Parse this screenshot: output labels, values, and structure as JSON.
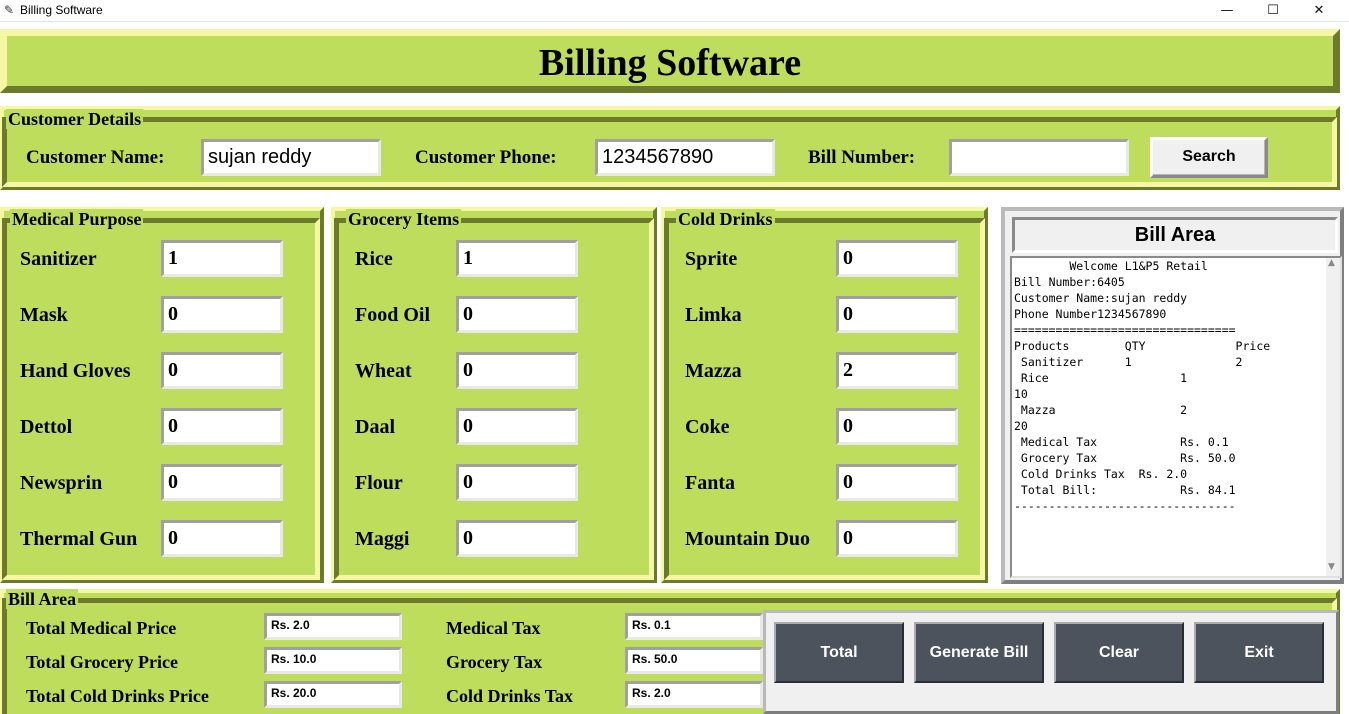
{
  "window": {
    "title": "Billing Software"
  },
  "header": {
    "title": "Billing Software"
  },
  "customer": {
    "frame_label": "Customer Details",
    "name_label": "Customer Name:",
    "name_value": "sujan reddy",
    "phone_label": "Customer Phone:",
    "phone_value": "1234567890",
    "bill_label": "Bill Number:",
    "bill_value": "",
    "search_label": "Search"
  },
  "medical": {
    "frame_label": "Medical Purpose",
    "items": [
      {
        "label": "Sanitizer",
        "value": "1"
      },
      {
        "label": "Mask",
        "value": "0"
      },
      {
        "label": "Hand Gloves",
        "value": "0"
      },
      {
        "label": "Dettol",
        "value": "0"
      },
      {
        "label": "Newsprin",
        "value": "0"
      },
      {
        "label": "Thermal Gun",
        "value": "0"
      }
    ]
  },
  "grocery": {
    "frame_label": "Grocery Items",
    "items": [
      {
        "label": "Rice",
        "value": "1"
      },
      {
        "label": "Food Oil",
        "value": "0"
      },
      {
        "label": "Wheat",
        "value": "0"
      },
      {
        "label": "Daal",
        "value": "0"
      },
      {
        "label": "Flour",
        "value": "0"
      },
      {
        "label": "Maggi",
        "value": "0"
      }
    ]
  },
  "drinks": {
    "frame_label": "Cold Drinks",
    "items": [
      {
        "label": "Sprite",
        "value": "0"
      },
      {
        "label": "Limka",
        "value": "0"
      },
      {
        "label": "Mazza",
        "value": "2"
      },
      {
        "label": "Coke",
        "value": "0"
      },
      {
        "label": "Fanta",
        "value": "0"
      },
      {
        "label": "Mountain Duo",
        "value": "0"
      }
    ]
  },
  "bill_panel": {
    "title": "Bill Area",
    "text": "        Welcome L1&P5 Retail\nBill Number:6405\nCustomer Name:sujan reddy\nPhone Number1234567890\n================================\nProducts        QTY             Price\n Sanitizer      1               2\n Rice                   1\n10\n Mazza                  2\n20\n Medical Tax            Rs. 0.1\n Grocery Tax            Rs. 50.0\n Cold Drinks Tax  Rs. 2.0\n Total Bill:            Rs. 84.1\n--------------------------------"
  },
  "summary": {
    "frame_label": "Bill Area",
    "medical_price_label": "Total Medical Price",
    "medical_price_value": "Rs. 2.0",
    "grocery_price_label": "Total Grocery Price",
    "grocery_price_value": "Rs. 10.0",
    "drinks_price_label": "Total Cold Drinks Price",
    "drinks_price_value": "Rs. 20.0",
    "medical_tax_label": "Medical Tax",
    "medical_tax_value": "Rs. 0.1",
    "grocery_tax_label": "Grocery Tax",
    "grocery_tax_value": "Rs. 50.0",
    "drinks_tax_label": "Cold Drinks Tax",
    "drinks_tax_value": "Rs. 2.0"
  },
  "actions": {
    "total_label": "Total",
    "generate_label": "Generate Bill",
    "clear_label": "Clear",
    "exit_label": "Exit"
  },
  "colors": {
    "panel": "#bedd5c",
    "button": "#4d535d"
  }
}
